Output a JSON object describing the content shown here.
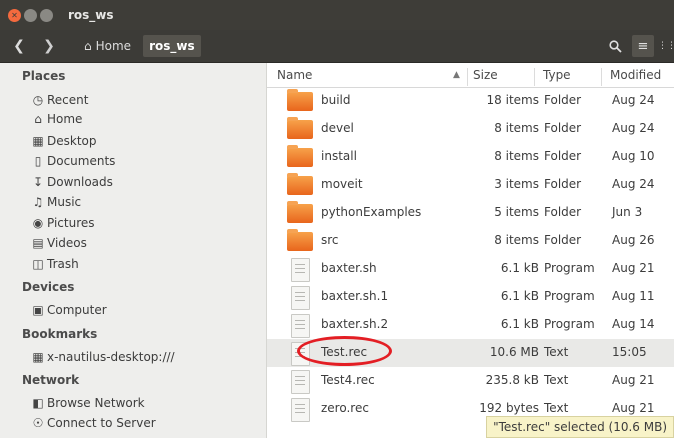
{
  "window": {
    "title": "ros_ws"
  },
  "toolbar": {
    "back_icon": "chevron-left-icon",
    "forward_icon": "chevron-right-icon",
    "breadcrumb": [
      "Home",
      "ros_ws"
    ],
    "search_icon": "search-icon",
    "menu_icon": "hamburger-menu-icon",
    "grid_icon": "grid-view-icon"
  },
  "sidebar": {
    "places_header": "Places",
    "places": [
      {
        "label": "Recent",
        "icon": "clock-icon"
      },
      {
        "label": "Home",
        "icon": "home-icon"
      },
      {
        "label": "Desktop",
        "icon": "folder-icon"
      },
      {
        "label": "Documents",
        "icon": "document-icon"
      },
      {
        "label": "Downloads",
        "icon": "download-icon"
      },
      {
        "label": "Music",
        "icon": "music-icon"
      },
      {
        "label": "Pictures",
        "icon": "camera-icon"
      },
      {
        "label": "Videos",
        "icon": "film-icon"
      },
      {
        "label": "Trash",
        "icon": "trash-icon"
      }
    ],
    "devices_header": "Devices",
    "devices": [
      {
        "label": "Computer",
        "icon": "drive-icon"
      }
    ],
    "bookmarks_header": "Bookmarks",
    "bookmarks": [
      {
        "label": "x-nautilus-desktop:///",
        "icon": "desktop-icon"
      }
    ],
    "network_header": "Network",
    "network": [
      {
        "label": "Browse Network",
        "icon": "network-icon"
      },
      {
        "label": "Connect to Server",
        "icon": "server-icon"
      }
    ]
  },
  "columns": {
    "name": "Name",
    "size": "Size",
    "type": "Type",
    "modified": "Modified"
  },
  "files": [
    {
      "name": "build",
      "size": "18 items",
      "type": "Folder",
      "modified": "Aug 24",
      "kind": "folder"
    },
    {
      "name": "devel",
      "size": "8 items",
      "type": "Folder",
      "modified": "Aug 24",
      "kind": "folder"
    },
    {
      "name": "install",
      "size": "8 items",
      "type": "Folder",
      "modified": "Aug 10",
      "kind": "folder"
    },
    {
      "name": "moveit",
      "size": "3 items",
      "type": "Folder",
      "modified": "Aug 24",
      "kind": "folder"
    },
    {
      "name": "pythonExamples",
      "size": "5 items",
      "type": "Folder",
      "modified": "Jun 3",
      "kind": "folder"
    },
    {
      "name": "src",
      "size": "8 items",
      "type": "Folder",
      "modified": "Aug 26",
      "kind": "folder"
    },
    {
      "name": "baxter.sh",
      "size": "6.1 kB",
      "type": "Program",
      "modified": "Aug 21",
      "kind": "doc"
    },
    {
      "name": "baxter.sh.1",
      "size": "6.1 kB",
      "type": "Program",
      "modified": "Aug 11",
      "kind": "doc"
    },
    {
      "name": "baxter.sh.2",
      "size": "6.1 kB",
      "type": "Program",
      "modified": "Aug 14",
      "kind": "doc"
    },
    {
      "name": "Test.rec",
      "size": "10.6 MB",
      "type": "Text",
      "modified": "15:05",
      "kind": "doc",
      "selected": true
    },
    {
      "name": "Test4.rec",
      "size": "235.8 kB",
      "type": "Text",
      "modified": "Aug 21",
      "kind": "doc"
    },
    {
      "name": "zero.rec",
      "size": "192 bytes",
      "type": "Text",
      "modified": "Aug 21",
      "kind": "doc"
    }
  ],
  "status": "\"Test.rec\" selected (10.6 MB)",
  "colors": {
    "highlight": "#e31e24",
    "folder": "#f08a2c",
    "titlebar": "#3e3d38"
  }
}
